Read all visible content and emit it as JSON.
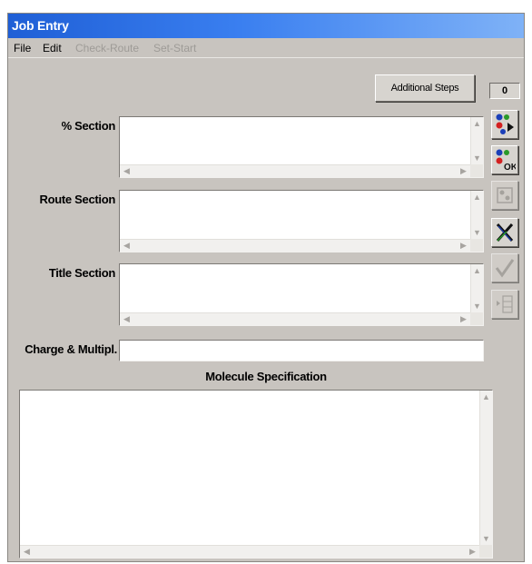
{
  "window": {
    "title": "Job Entry"
  },
  "menu": {
    "file": "File",
    "edit": "Edit",
    "check_route": "Check-Route",
    "set_start": "Set-Start"
  },
  "toolbar": {
    "additional_steps": "Additional Steps",
    "counter": "0"
  },
  "sections": {
    "percent_label": "% Section",
    "route_label": "Route Section",
    "title_label": "Title Section",
    "charge_label": "Charge & Multipl.",
    "molecule_heading": "Molecule Specification"
  },
  "side_tools": [
    {
      "name": "run-job-icon",
      "enabled": true
    },
    {
      "name": "ok-icon",
      "enabled": true
    },
    {
      "name": "edit-job-icon",
      "enabled": false
    },
    {
      "name": "cancel-icon",
      "enabled": true
    },
    {
      "name": "check-icon",
      "enabled": false
    },
    {
      "name": "list-icon",
      "enabled": false
    }
  ],
  "colors": {
    "titlebar_start": "#1f5fd6",
    "titlebar_end": "#7fb2f7",
    "window_bg": "#c8c4bf"
  }
}
